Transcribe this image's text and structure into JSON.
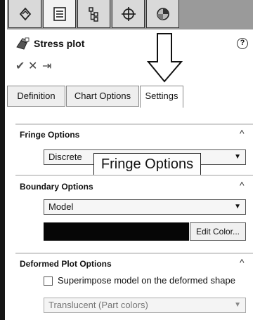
{
  "toolbar_tabs": [
    {
      "icon": "feature-manager-icon"
    },
    {
      "icon": "property-manager-icon"
    },
    {
      "icon": "configuration-manager-icon"
    },
    {
      "icon": "dimxpert-icon"
    },
    {
      "icon": "display-manager-icon"
    }
  ],
  "header": {
    "title": "Stress plot",
    "help_symbol": "?"
  },
  "actions": {
    "ok": "✔",
    "cancel": "✕",
    "pin": "⇥"
  },
  "tabs": [
    {
      "label": "Definition"
    },
    {
      "label": "Chart Options"
    },
    {
      "label": "Settings",
      "active": true
    }
  ],
  "fringe": {
    "title": "Fringe Options",
    "value": "Discrete",
    "tooltip": "Fringe Options"
  },
  "boundary": {
    "title": "Boundary Options",
    "value": "Model",
    "color": "#060606",
    "edit_color": "Edit Color..."
  },
  "deformed": {
    "title": "Deformed Plot Options",
    "superimpose_label": "Superimpose model on the deformed shape",
    "superimpose_checked": false,
    "style": "Translucent (Part colors)"
  }
}
